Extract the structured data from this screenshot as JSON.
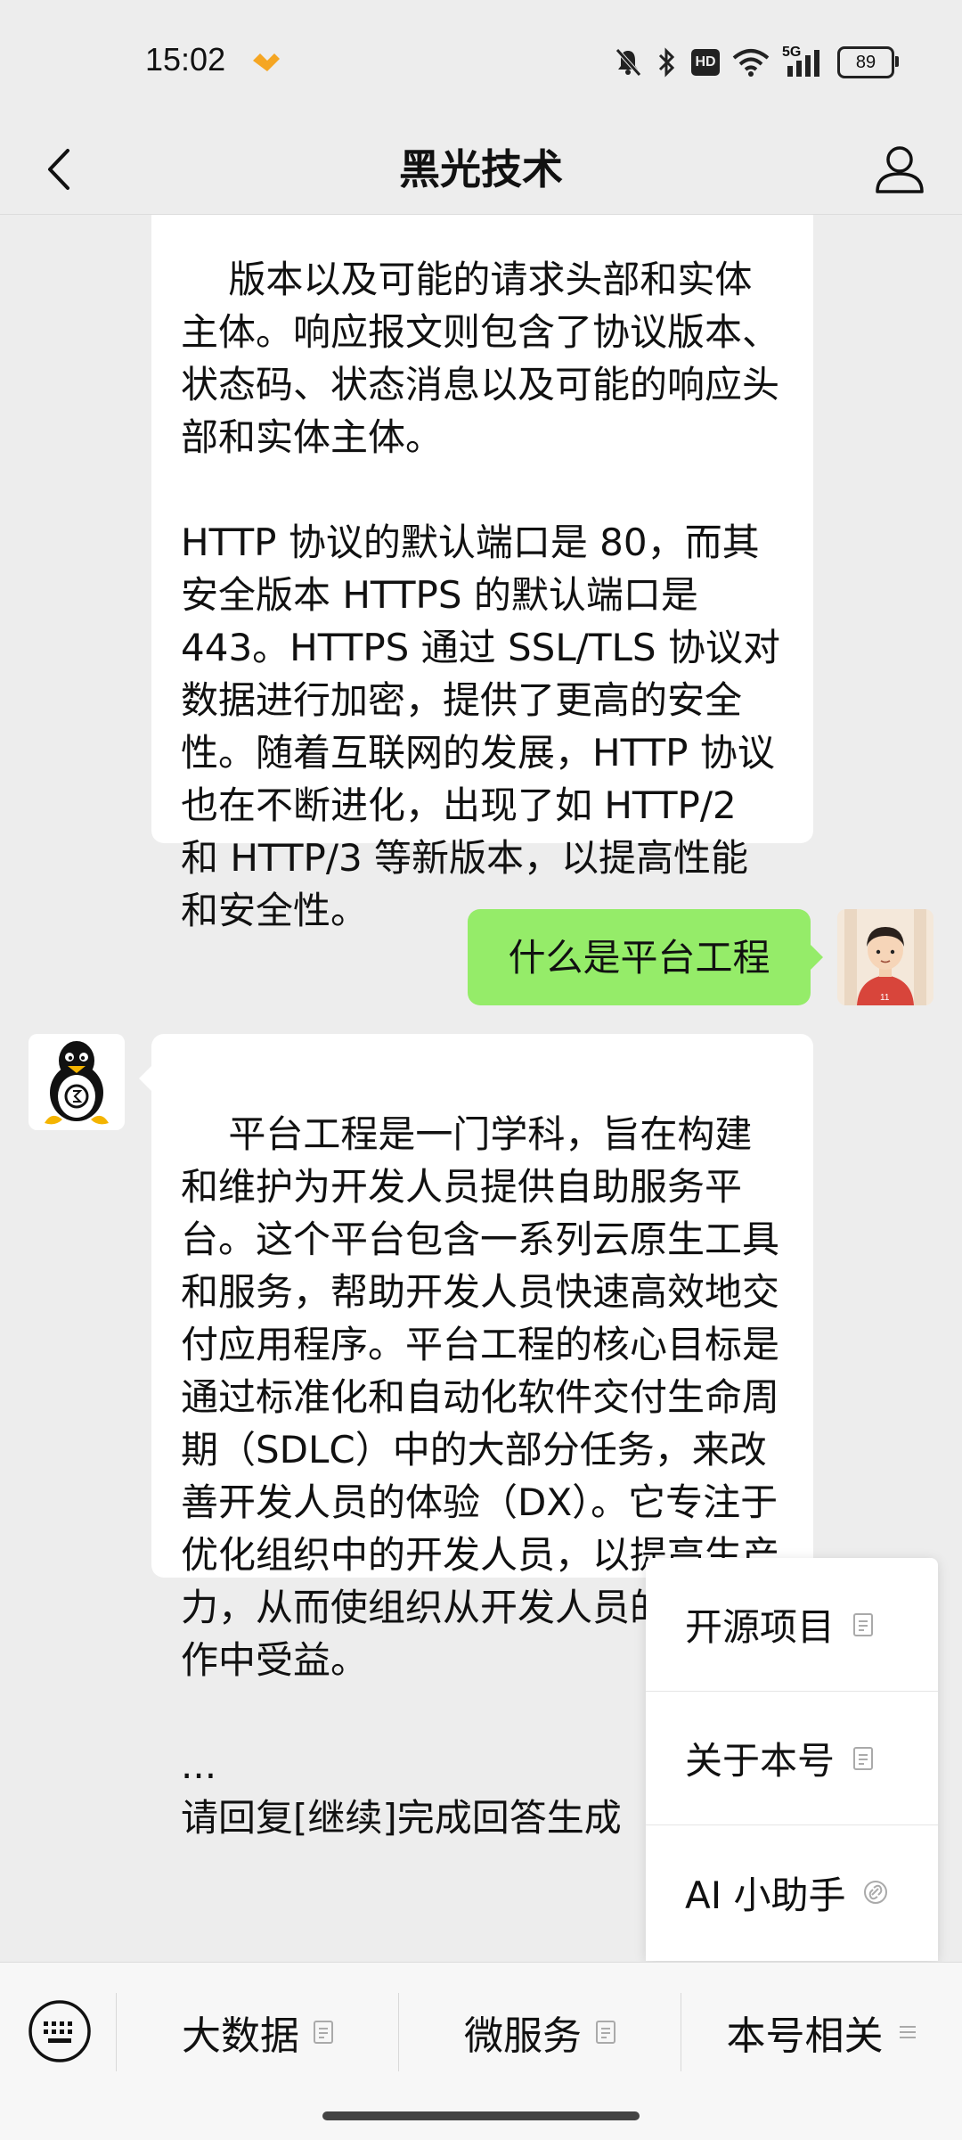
{
  "status_bar": {
    "time": "15:02",
    "network": "5G",
    "hd": "HD",
    "battery": "89"
  },
  "header": {
    "title": "黑光技术"
  },
  "messages": {
    "first_bot_text": "版本以及可能的请求头部和实体主体。响应报文则包含了协议版本、状态码、状态消息以及可能的响应头部和实体主体。\n\nHTTP 协议的默认端口是 80，而其安全版本 HTTPS 的默认端口是 443。HTTPS 通过 SSL/TLS 协议对数据进行加密，提供了更高的安全性。随着互联网的发展，HTTP 协议也在不断进化，出现了如 HTTP/2 和 HTTP/3 等新版本，以提高性能和安全性。",
    "user_text": "什么是平台工程",
    "second_bot_text": "平台工程是一门学科，旨在构建和维护为开发人员提供自助服务平台。这个平台包含一系列云原生工具和服务，帮助开发人员快速高效地交付应用程序。平台工程的核心目标是通过标准化和自动化软件交付生命周期（SDLC）中的大部分任务，来改善开发人员的体验（DX）。它专注于优化组织中的开发人员，以提高生产力，从而使组织从开发人员的高效工作中受益。\n\n...\n请回复[继续]完成回答生成"
  },
  "popup_menu": {
    "items": [
      {
        "label": "开源项目",
        "icon": "document-icon"
      },
      {
        "label": "关于本号",
        "icon": "document-icon"
      },
      {
        "label": "AI 小助手",
        "icon": "link-icon"
      }
    ]
  },
  "bottom_menu": {
    "items": [
      {
        "label": "大数据",
        "icon": "document-icon"
      },
      {
        "label": "微服务",
        "icon": "document-icon"
      },
      {
        "label": "本号相关",
        "icon": "menu-lines-icon"
      }
    ]
  },
  "colors": {
    "background": "#ededed",
    "user_bubble": "#95ec69",
    "bot_bubble": "#ffffff",
    "accent_orange": "#f5a623"
  }
}
